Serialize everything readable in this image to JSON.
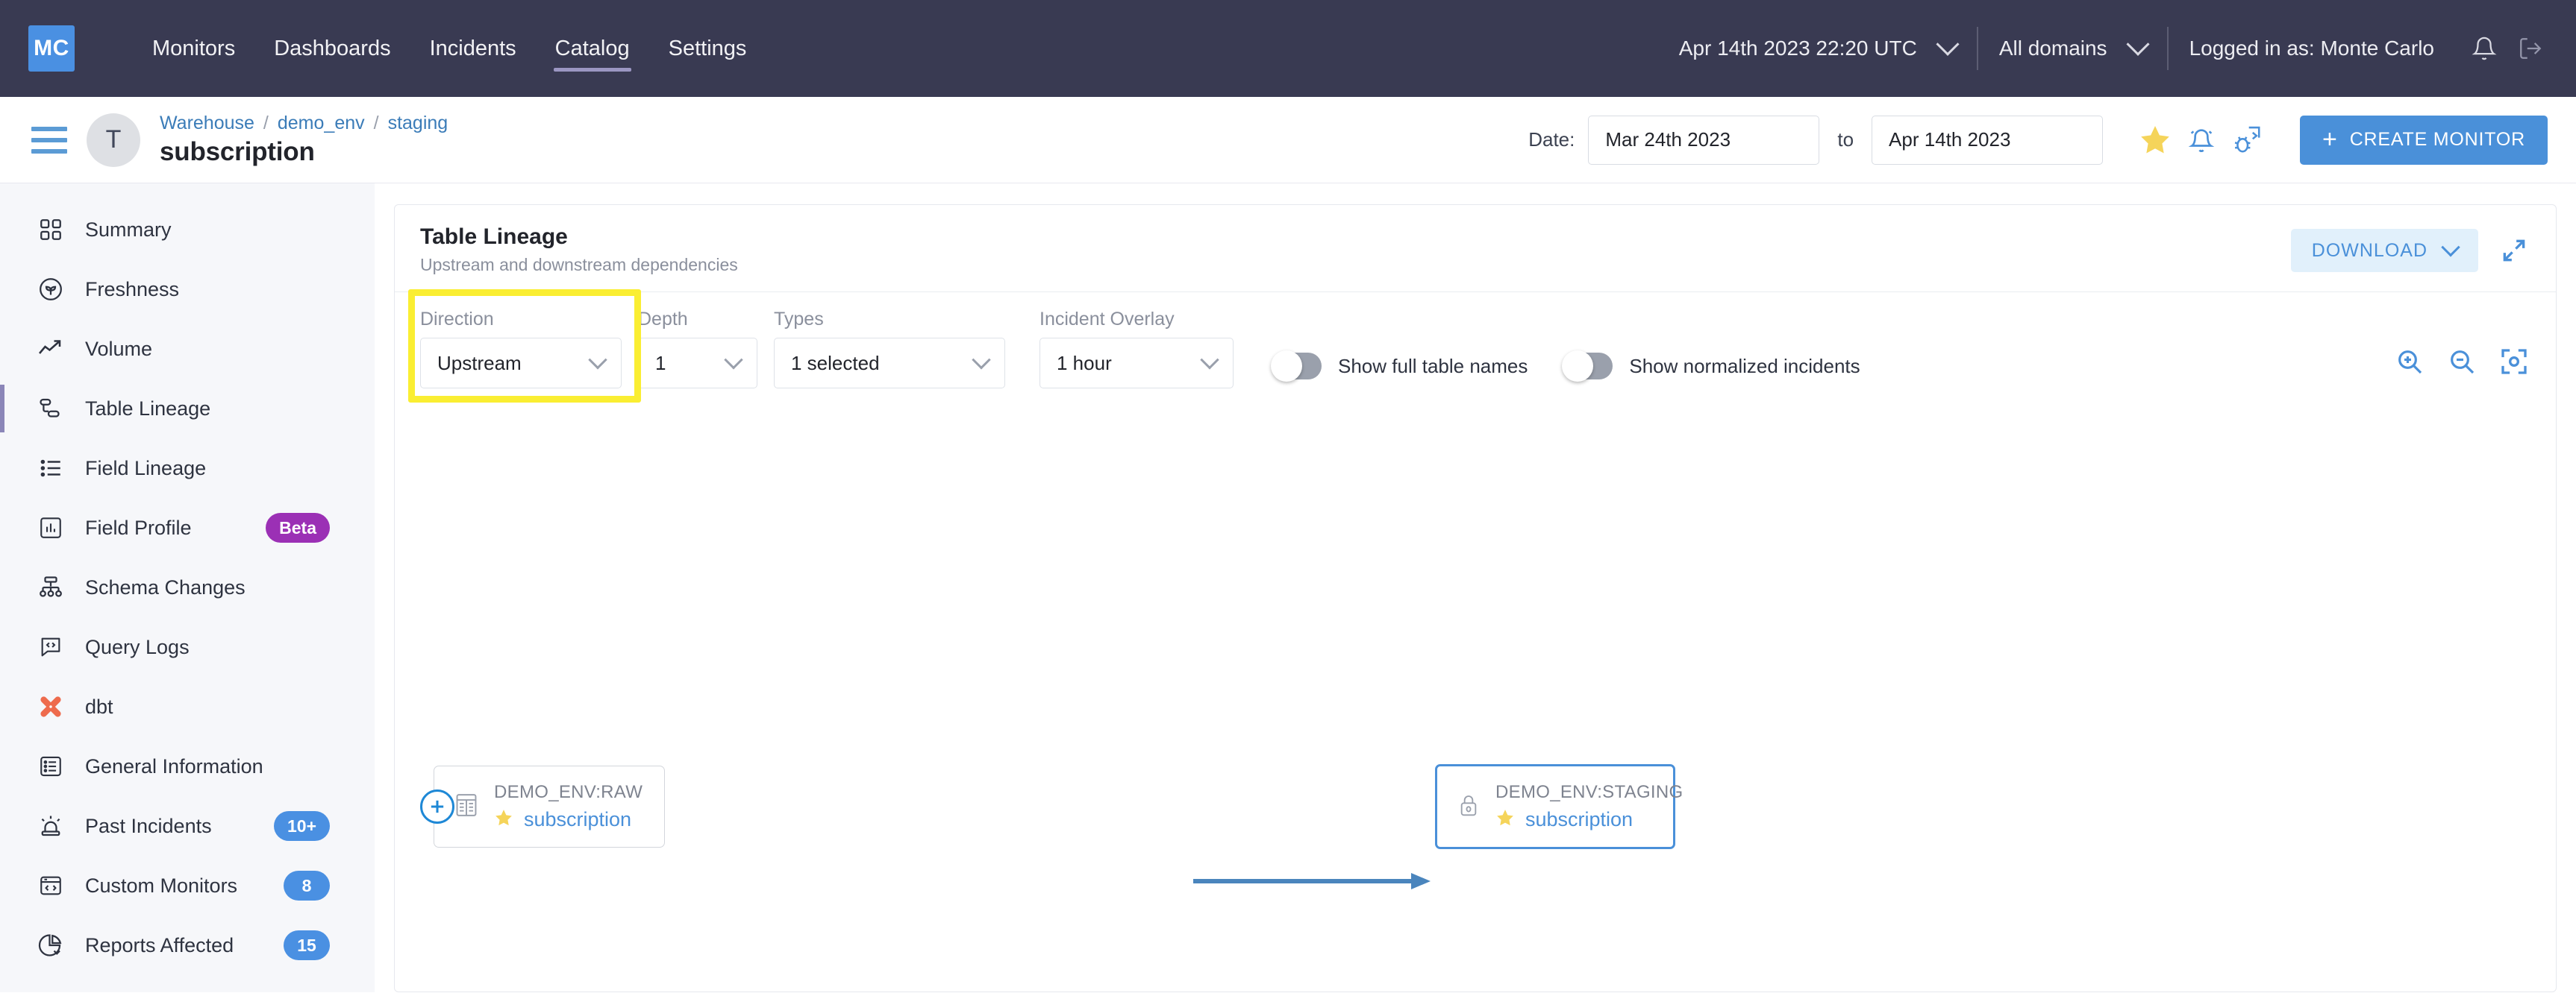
{
  "topnav": {
    "logo": "MC",
    "links": [
      {
        "label": "Monitors",
        "active": false
      },
      {
        "label": "Dashboards",
        "active": false
      },
      {
        "label": "Incidents",
        "active": false
      },
      {
        "label": "Catalog",
        "active": true
      },
      {
        "label": "Settings",
        "active": false
      }
    ],
    "timestamp": "Apr 14th 2023 22:20 UTC",
    "domain_selector": "All domains",
    "logged_in_as": "Logged in as: Monte Carlo",
    "bell_icon": "bell-icon",
    "logout_icon": "logout-icon"
  },
  "subheader": {
    "avatar_letter": "T",
    "breadcrumbs": [
      "Warehouse",
      "demo_env",
      "staging"
    ],
    "breadcrumb_separator": "/",
    "page_title": "subscription",
    "date_label": "Date:",
    "date_from": "Mar 24th 2023",
    "date_to_label": "to",
    "date_to": "Apr 14th 2023",
    "icons": [
      "star-icon",
      "notification-bell-icon",
      "debug-bug-icon"
    ],
    "create_monitor_label": "CREATE MONITOR",
    "create_monitor_plus": "+"
  },
  "sidebar": {
    "items": [
      {
        "label": "Summary",
        "icon": "grid-icon",
        "badge": null,
        "active": false
      },
      {
        "label": "Freshness",
        "icon": "sprout-circle-icon",
        "badge": null,
        "active": false
      },
      {
        "label": "Volume",
        "icon": "trend-up-icon",
        "badge": null,
        "active": false
      },
      {
        "label": "Table Lineage",
        "icon": "table-lineage-icon",
        "badge": null,
        "active": true
      },
      {
        "label": "Field Lineage",
        "icon": "list-bullet-icon",
        "badge": null,
        "active": false
      },
      {
        "label": "Field Profile",
        "icon": "bar-chart-box-icon",
        "badge": "Beta",
        "badge_color": "purple",
        "active": false
      },
      {
        "label": "Schema Changes",
        "icon": "hierarchy-icon",
        "badge": null,
        "active": false
      },
      {
        "label": "Query Logs",
        "icon": "code-bubble-icon",
        "badge": null,
        "active": false
      },
      {
        "label": "dbt",
        "icon": "dbt-logo-icon",
        "badge": null,
        "active": false
      },
      {
        "label": "General Information",
        "icon": "info-list-icon",
        "badge": null,
        "active": false
      },
      {
        "label": "Past Incidents",
        "icon": "siren-icon",
        "badge": "10+",
        "badge_color": "blue",
        "active": false
      },
      {
        "label": "Custom Monitors",
        "icon": "browser-code-icon",
        "badge": "8",
        "badge_color": "blue",
        "active": false
      },
      {
        "label": "Reports Affected",
        "icon": "pie-chart-icon",
        "badge": "15",
        "badge_color": "blue",
        "active": false
      }
    ]
  },
  "panel": {
    "title": "Table Lineage",
    "subtitle": "Upstream and downstream dependencies",
    "download_label": "DOWNLOAD",
    "expand_icon": "expand-diagonal-icon",
    "filters": [
      {
        "name": "direction",
        "label": "Direction",
        "value": "Upstream",
        "highlighted": true
      },
      {
        "name": "depth",
        "label": "Depth",
        "value": "1",
        "highlighted": false
      },
      {
        "name": "types",
        "label": "Types",
        "value": "1 selected",
        "highlighted": false
      },
      {
        "name": "incident_overlay",
        "label": "Incident Overlay",
        "value": "1 hour",
        "highlighted": false
      }
    ],
    "toggles": [
      {
        "name": "show-full-table-names",
        "label": "Show full table names",
        "on": false
      },
      {
        "name": "show-normalized-incidents",
        "label": "Show normalized incidents",
        "on": false
      }
    ],
    "zoom_controls": [
      "zoom-in-icon",
      "zoom-out-icon",
      "fit-to-screen-icon"
    ],
    "highlight_color": "#FAEE32"
  },
  "lineage": {
    "nodes": [
      {
        "id": "raw",
        "schema": "DEMO_ENV:RAW",
        "name": "subscription",
        "icon": "table-icon",
        "selected": false,
        "has_expand": true,
        "starred": true
      },
      {
        "id": "staging",
        "schema": "DEMO_ENV:STAGING",
        "name": "subscription",
        "icon": "lock-icon",
        "selected": true,
        "has_expand": false,
        "starred": true
      }
    ],
    "edges": [
      {
        "from": "raw",
        "to": "staging"
      }
    ]
  },
  "colors": {
    "nav_bg": "#393A52",
    "accent_blue": "#4A90D9",
    "brand_blue": "#4A90E2",
    "highlight_yellow": "#FAEE32",
    "beta_purple": "#9B30B5",
    "star_yellow": "#F5D45A"
  }
}
